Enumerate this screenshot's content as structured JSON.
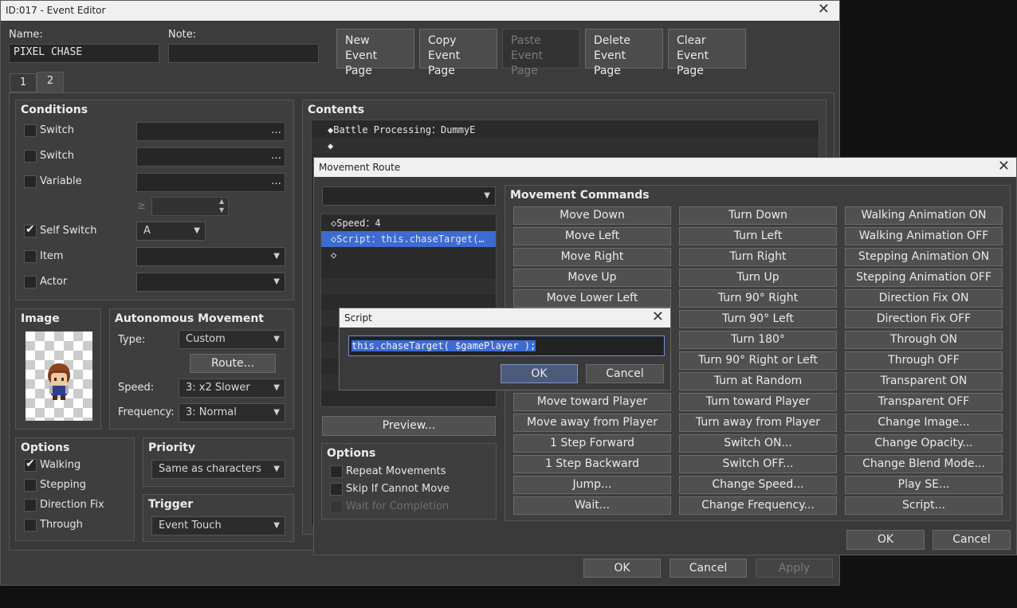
{
  "event_editor": {
    "title": "ID:017 - Event Editor",
    "name_label": "Name:",
    "name_value": "PIXEL CHASE",
    "note_label": "Note:",
    "note_value": "",
    "page_buttons": {
      "new": [
        "New",
        "Event Page"
      ],
      "copy": [
        "Copy",
        "Event Page"
      ],
      "paste": [
        "Paste",
        "Event Page"
      ],
      "delete": [
        "Delete",
        "Event Page"
      ],
      "clear": [
        "Clear",
        "Event Page"
      ]
    },
    "tabs": [
      "1",
      "2"
    ],
    "active_tab": "2",
    "conditions": {
      "title": "Conditions",
      "switch1": {
        "label": "Switch",
        "checked": false,
        "value": ""
      },
      "switch2": {
        "label": "Switch",
        "checked": false,
        "value": ""
      },
      "variable": {
        "label": "Variable",
        "checked": false,
        "value": "",
        "op": "≥",
        "num": ""
      },
      "self_switch": {
        "label": "Self Switch",
        "checked": true,
        "value": "A"
      },
      "item": {
        "label": "Item",
        "checked": false,
        "value": ""
      },
      "actor": {
        "label": "Actor",
        "checked": false,
        "value": ""
      },
      "ellipsis": "…"
    },
    "image": {
      "title": "Image"
    },
    "autonomous": {
      "title": "Autonomous Movement",
      "type_label": "Type:",
      "type_value": "Custom",
      "route_button": "Route...",
      "speed_label": "Speed:",
      "speed_value": "3: x2 Slower",
      "freq_label": "Frequency:",
      "freq_value": "3: Normal"
    },
    "options": {
      "title": "Options",
      "walking": {
        "label": "Walking",
        "checked": true
      },
      "stepping": {
        "label": "Stepping",
        "checked": false
      },
      "direction_fix": {
        "label": "Direction Fix",
        "checked": false
      },
      "through": {
        "label": "Through",
        "checked": false
      }
    },
    "priority": {
      "title": "Priority",
      "value": "Same as characters"
    },
    "trigger": {
      "title": "Trigger",
      "value": "Event Touch"
    },
    "contents": {
      "title": "Contents",
      "rows": [
        "◆Battle Processing：DummyE",
        "◆"
      ]
    },
    "ok": "OK",
    "cancel": "Cancel",
    "apply": "Apply"
  },
  "movement_route": {
    "title": "Movement Route",
    "target": "",
    "list": [
      "◇Speed：4",
      "◇Script：this.chaseTarget(…",
      "◇"
    ],
    "preview": "Preview...",
    "options": {
      "title": "Options",
      "repeat": {
        "label": "Repeat Movements",
        "checked": false
      },
      "skip": {
        "label": "Skip If Cannot Move",
        "checked": false
      },
      "wait": {
        "label": "Wait for Completion",
        "checked": false
      }
    },
    "commands_title": "Movement Commands",
    "col1": [
      "Move Down",
      "Move Left",
      "Move Right",
      "Move Up",
      "Move Lower Left",
      "",
      "",
      "",
      "",
      "Move toward Player",
      "Move away from Player",
      "1 Step Forward",
      "1 Step Backward",
      "Jump...",
      "Wait..."
    ],
    "col2": [
      "Turn Down",
      "Turn Left",
      "Turn Right",
      "Turn Up",
      "Turn 90° Right",
      "Turn 90° Left",
      "Turn 180°",
      "Turn 90° Right or Left",
      "Turn at Random",
      "Turn toward Player",
      "Turn away from Player",
      "Switch ON...",
      "Switch OFF...",
      "Change Speed...",
      "Change Frequency..."
    ],
    "col3": [
      "Walking Animation ON",
      "Walking Animation OFF",
      "Stepping Animation ON",
      "Stepping Animation OFF",
      "Direction Fix ON",
      "Direction Fix OFF",
      "Through ON",
      "Through OFF",
      "Transparent ON",
      "Transparent OFF",
      "Change Image...",
      "Change Opacity...",
      "Change Blend Mode...",
      "Play SE...",
      "Script..."
    ],
    "ok": "OK",
    "cancel": "Cancel"
  },
  "script_dialog": {
    "title": "Script",
    "value": "this.chaseTarget( $gamePlayer );",
    "ok": "OK",
    "cancel": "Cancel"
  }
}
